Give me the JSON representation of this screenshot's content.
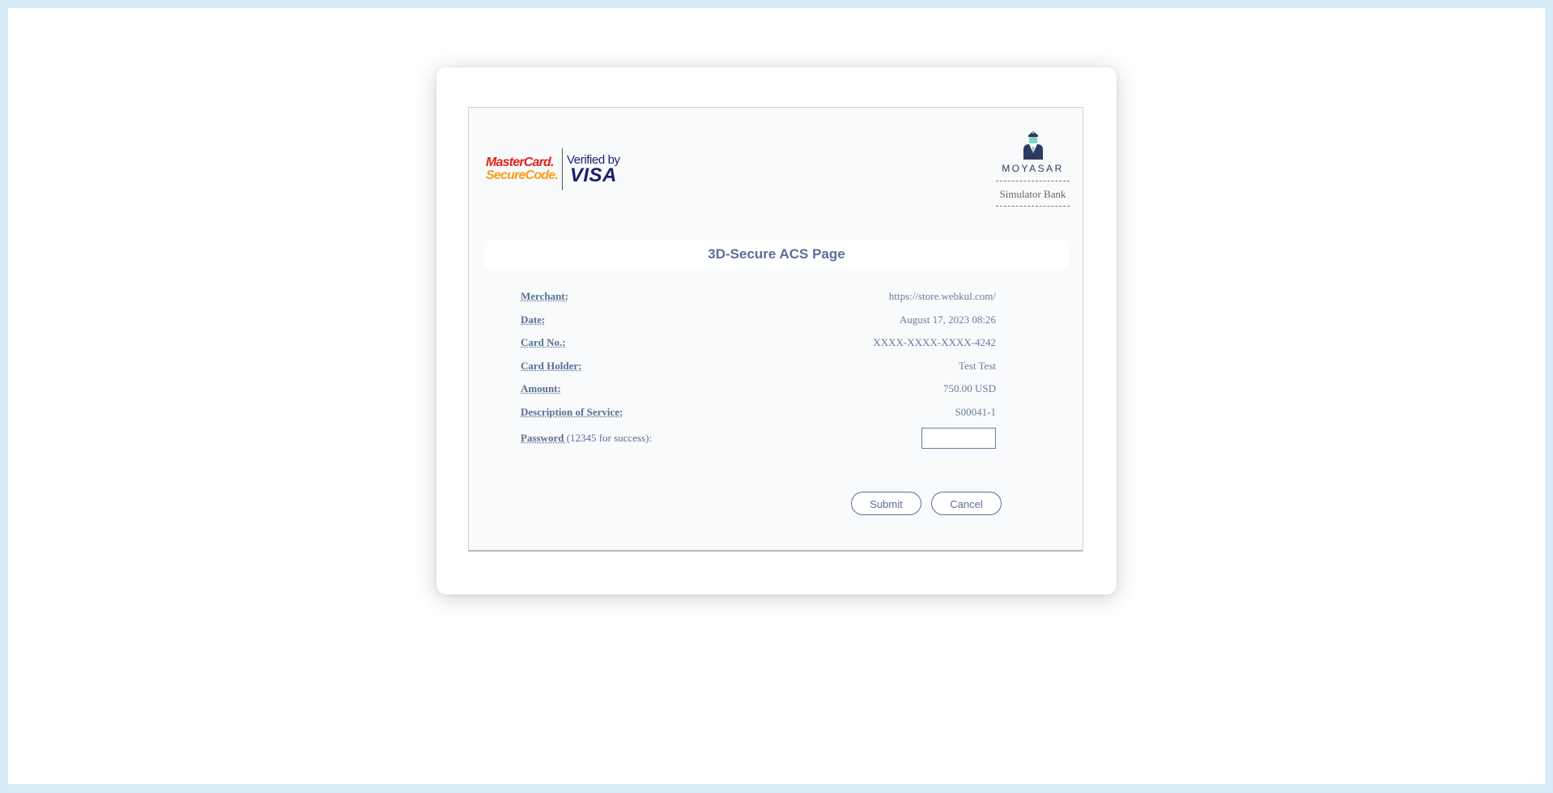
{
  "brands": {
    "mastercard_line1": "MasterCard.",
    "mastercard_line2": "SecureCode.",
    "visa_line1": "Verified by",
    "visa_line2": "VISA"
  },
  "bank": {
    "name": "MOYASAR",
    "subtitle": "Simulator Bank"
  },
  "page_title": "3D-Secure ACS Page",
  "details": [
    {
      "label": "Merchant:",
      "value": "https://store.webkul.com/"
    },
    {
      "label": "Date:",
      "value": "August 17, 2023 08:26"
    },
    {
      "label": "Card No.:",
      "value": "XXXX-XXXX-XXXX-4242"
    },
    {
      "label": "Card Holder:",
      "value": "Test Test"
    },
    {
      "label": "Amount:",
      "value": "750.00 USD"
    },
    {
      "label": "Description of Service:",
      "value": "S00041-1"
    }
  ],
  "password": {
    "label": "Password ",
    "hint": "(12345 for success):",
    "value": ""
  },
  "actions": {
    "submit_label": "Submit",
    "cancel_label": "Cancel"
  },
  "colors": {
    "accent": "#5a6f96",
    "page_border": "#d6edf9"
  }
}
